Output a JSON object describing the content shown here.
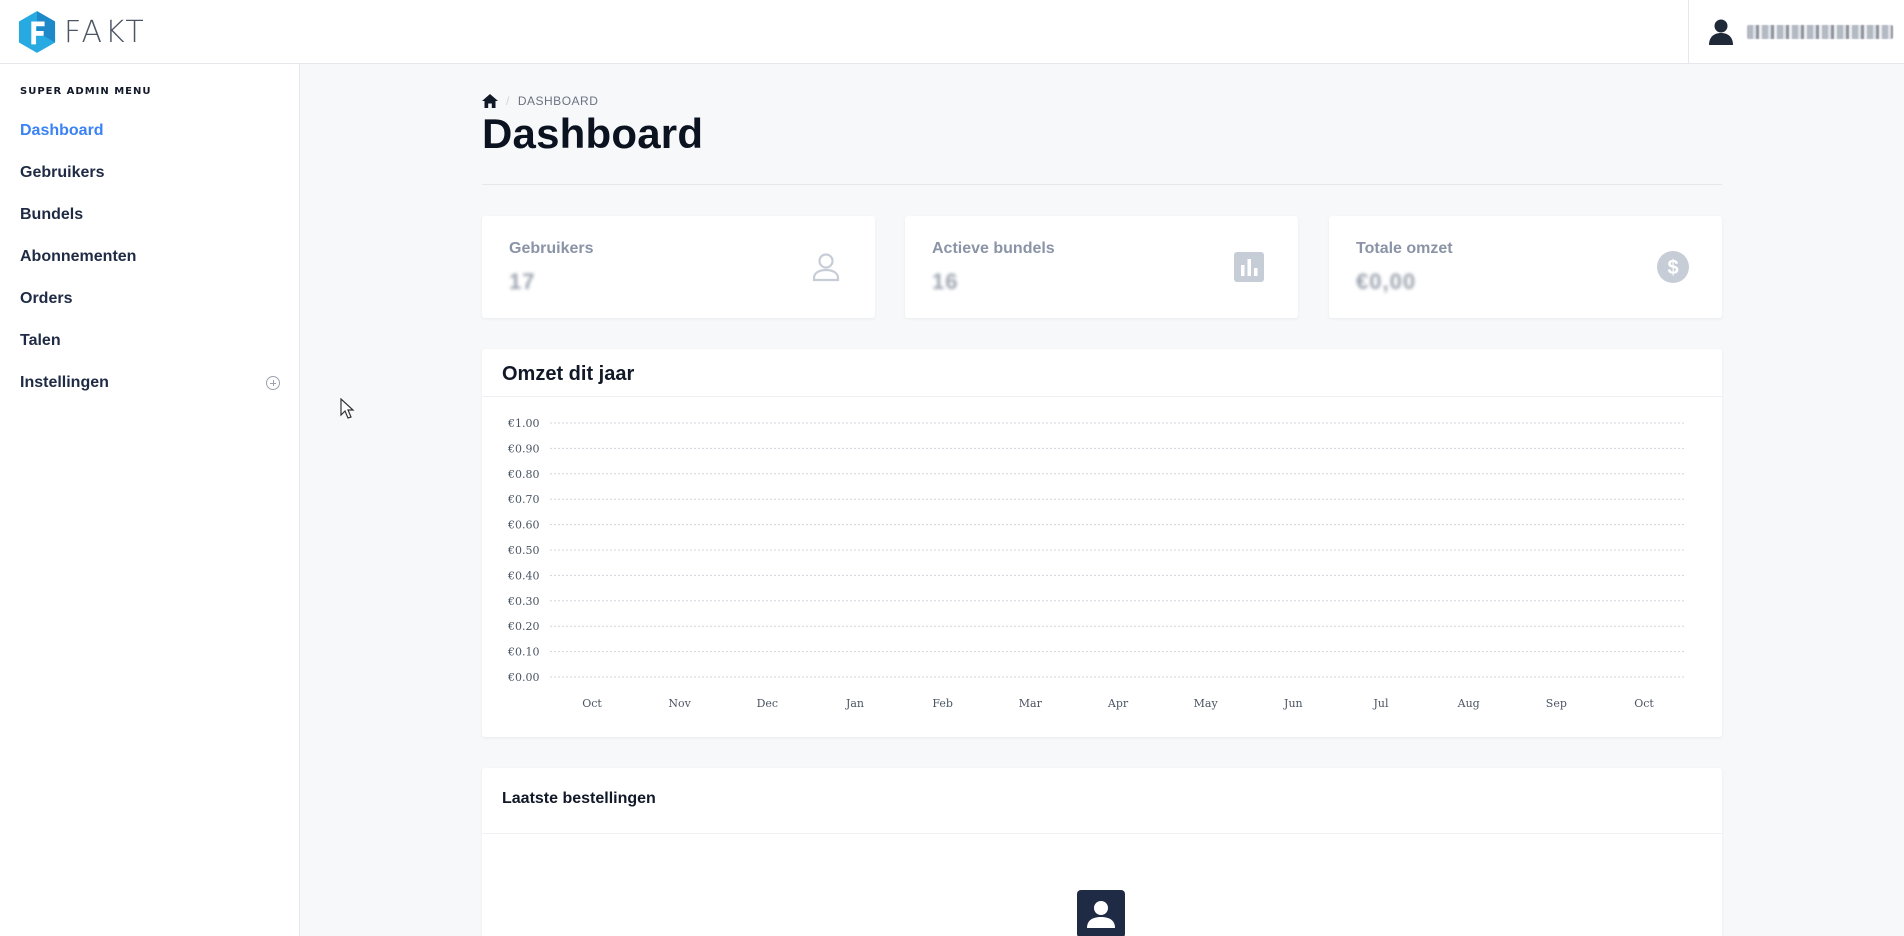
{
  "brand": {
    "name": "FAKT",
    "accent": "#3b82f6",
    "logo_color": "#27a9e1"
  },
  "header": {
    "user_icon": "user-icon",
    "user_name": "Beheerder Gebruiker"
  },
  "sidebar": {
    "heading": "SUPER ADMIN MENU",
    "items": [
      {
        "label": "Dashboard",
        "active": true
      },
      {
        "label": "Gebruikers"
      },
      {
        "label": "Bundels"
      },
      {
        "label": "Abonnementen"
      },
      {
        "label": "Orders"
      },
      {
        "label": "Talen"
      },
      {
        "label": "Instellingen",
        "icon": "plus-circle-icon"
      }
    ]
  },
  "breadcrumb": {
    "home_icon": "home-icon",
    "separator": "/",
    "current": "DASHBOARD"
  },
  "page": {
    "title": "Dashboard"
  },
  "stats": [
    {
      "label": "Gebruikers",
      "value": "17",
      "icon": "user-icon"
    },
    {
      "label": "Actieve bundels",
      "value": "16",
      "icon": "bar-chart-icon"
    },
    {
      "label": "Totale omzet",
      "value": "€0,00",
      "icon": "dollar-circle-icon"
    }
  ],
  "chart_card": {
    "title": "Omzet dit jaar"
  },
  "chart_data": {
    "type": "line",
    "categories": [
      "Oct",
      "Nov",
      "Dec",
      "Jan",
      "Feb",
      "Mar",
      "Apr",
      "May",
      "Jun",
      "Jul",
      "Aug",
      "Sep",
      "Oct"
    ],
    "series": [
      {
        "values": [
          0,
          0,
          0,
          0,
          0,
          0,
          0,
          0,
          0,
          0,
          0,
          0,
          0
        ]
      }
    ],
    "yticks": [
      "€0.00",
      "€0.10",
      "€0.20",
      "€0.30",
      "€0.40",
      "€0.50",
      "€0.60",
      "€0.70",
      "€0.80",
      "€0.90",
      "€1.00"
    ],
    "ylim": [
      0,
      1
    ],
    "grid": true,
    "legend": "none"
  },
  "orders": {
    "title": "Laatste bestellingen",
    "empty_icon": "user-card-icon"
  }
}
